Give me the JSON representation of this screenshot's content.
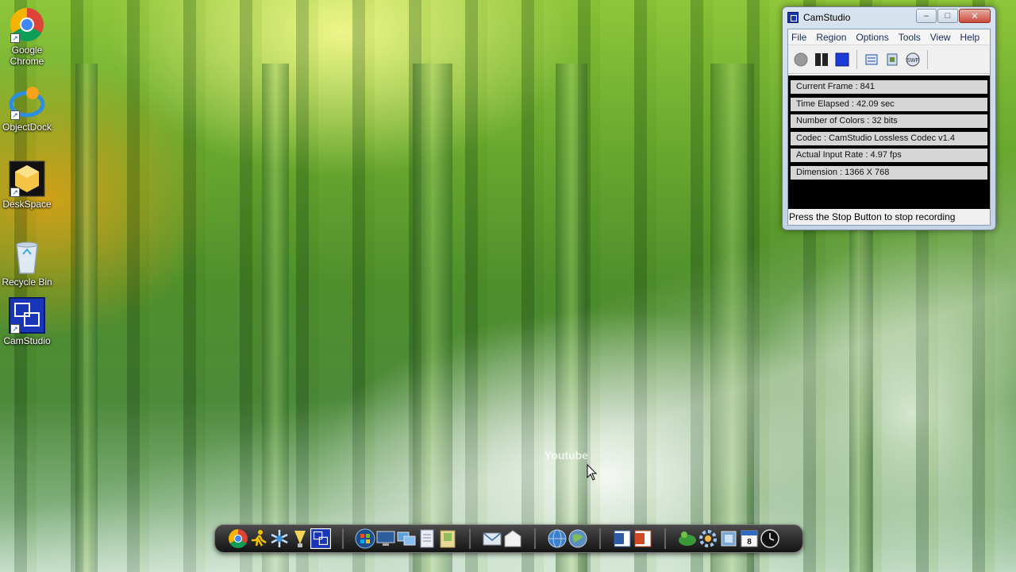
{
  "desktop": {
    "icons": [
      {
        "label_line1": "Google",
        "label_line2": "Chrome",
        "icon": "chrome-icon"
      },
      {
        "label_line1": "ObjectDock",
        "label_line2": "",
        "icon": "objectdock-icon"
      },
      {
        "label_line1": "DeskSpace",
        "label_line2": "",
        "icon": "deskspace-icon"
      },
      {
        "label_line1": "Recycle Bin",
        "label_line2": "",
        "icon": "recycle-bin-icon"
      },
      {
        "label_line1": "CamStudio",
        "label_line2": "",
        "icon": "camstudio-icon"
      }
    ],
    "watermark": "Youtube"
  },
  "window": {
    "title": "CamStudio",
    "controls": {
      "minimize": "–",
      "maximize": "□",
      "close": "✕"
    },
    "menu": [
      "File",
      "Region",
      "Options",
      "Tools",
      "View",
      "Help"
    ],
    "toolbar": [
      "record-icon",
      "pause-icon",
      "stop-icon",
      "autopan-icon",
      "annotation-icon",
      "swf-icon"
    ],
    "toolbar_swf_label": "SWF",
    "stats": [
      "Current Frame : 841",
      "Time Elapsed  : 42.09 sec",
      "Number of Colors  : 32 bits",
      "Codec  : CamStudio Lossless Codec v1.4",
      "Actual Input Rate  : 4.97 fps",
      "Dimension  : 1366 X 768"
    ],
    "status": "Press the Stop Button to stop recording"
  },
  "dock": {
    "groups": [
      [
        "chrome-icon",
        "runner-icon",
        "snowflake-icon",
        "bulb-icon",
        "camstudio-icon"
      ],
      [
        "windows-start-icon",
        "computer-icon",
        "network-icon",
        "documents-icon",
        "folder-icon"
      ],
      [
        "mail-icon",
        "letter-icon"
      ],
      [
        "globe-icon",
        "world-network-icon"
      ],
      [
        "word-icon",
        "powerpoint-icon"
      ],
      [
        "game-icon",
        "settings-icon",
        "tools-icon",
        "calendar-icon",
        "clock-icon"
      ]
    ],
    "calendar_day": "8"
  },
  "colors": {
    "accent": "#1a36b8",
    "stat_bg": "#d6d6d6",
    "stat_panel": "#000000"
  }
}
